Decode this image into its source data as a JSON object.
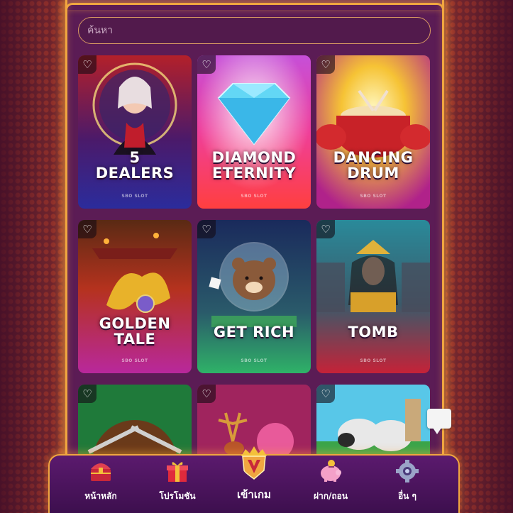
{
  "search": {
    "placeholder": "ค้นหา"
  },
  "games": [
    {
      "title_line1": "5",
      "title_line2": "DEALERS",
      "provider": "SBO SLOT",
      "favorite": false
    },
    {
      "title_line1": "DIAMOND",
      "title_line2": "ETERNITY",
      "provider": "SBO SLOT",
      "favorite": false
    },
    {
      "title_line1": "DANCING",
      "title_line2": "DRUM",
      "provider": "SBO SLOT",
      "favorite": false
    },
    {
      "title_line1": "GOLDEN",
      "title_line2": "TALE",
      "provider": "SBO SLOT",
      "favorite": false
    },
    {
      "title_line1": "GET RICH",
      "title_line2": "",
      "provider": "SBO SLOT",
      "favorite": false
    },
    {
      "title_line1": "TOMB",
      "title_line2": "",
      "provider": "SBO SLOT",
      "favorite": false
    },
    {
      "title_line1": "",
      "title_line2": "",
      "provider": "",
      "favorite": false
    },
    {
      "title_line1": "",
      "title_line2": "",
      "provider": "",
      "favorite": false
    },
    {
      "title_line1": "",
      "title_line2": "",
      "provider": "",
      "favorite": false
    }
  ],
  "nav": [
    {
      "label": "หน้าหลัก",
      "icon": "treasure-chest-icon"
    },
    {
      "label": "โปรโมชัน",
      "icon": "gift-box-icon"
    },
    {
      "label": "เข้าเกม",
      "icon": "v-shield-icon",
      "active": true
    },
    {
      "label": "ฝาก/ถอน",
      "icon": "piggy-bank-icon"
    },
    {
      "label": "อื่น ๆ",
      "icon": "gear-icon"
    }
  ],
  "colors": {
    "accent_gold": "#f0a640",
    "panel": "#5b1c55"
  }
}
